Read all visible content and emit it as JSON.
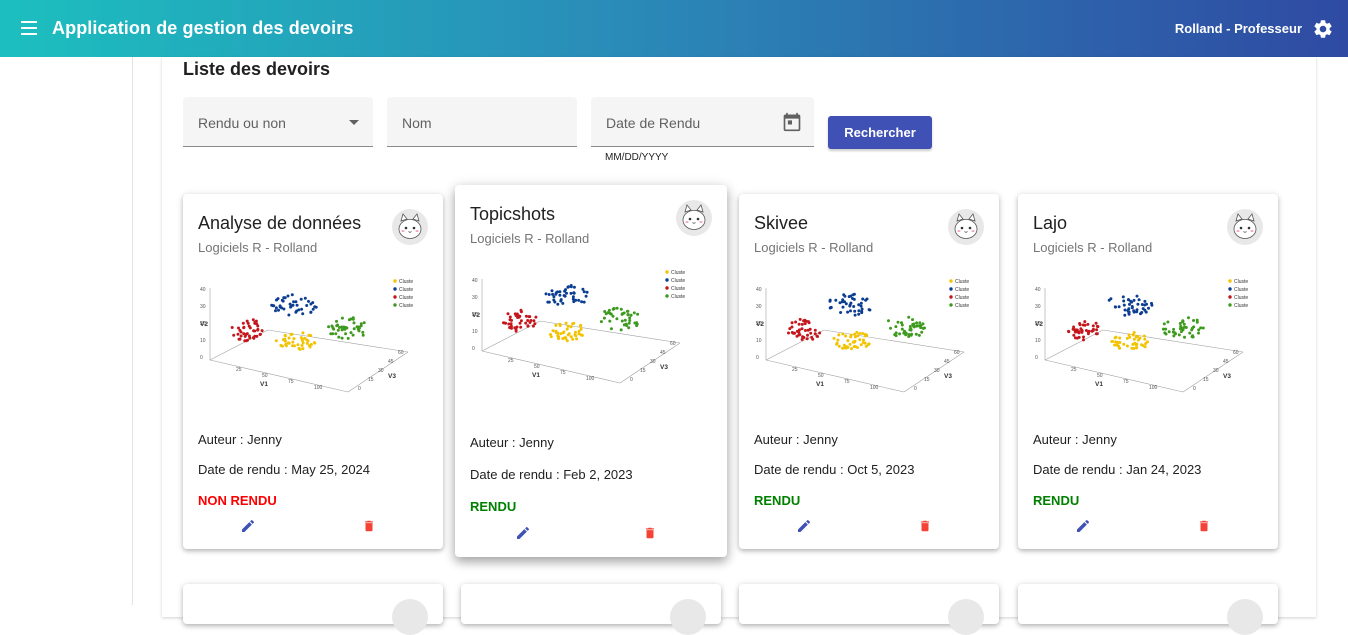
{
  "toolbar": {
    "title": "Application de gestion des devoirs",
    "user": "Rolland - Professeur",
    "menu_icon": "menu-icon",
    "settings_icon": "gear-icon",
    "gradient": [
      "#1cbfbf",
      "#2f4aa3"
    ]
  },
  "list": {
    "title": "Liste des devoirs",
    "filters": {
      "rendu_label": "Rendu ou non",
      "nom_label": "Nom",
      "date_label": "Date de Rendu",
      "date_hint": "MM/DD/YYYY"
    },
    "search_button": "Rechercher"
  },
  "colors": {
    "primary": "#3f51b5",
    "rendu": "#008000",
    "non_rendu": "#ff0000",
    "delete": "#f44336"
  },
  "chart_legend": [
    "Cluster 1",
    "Cluster 2",
    "Cluster 3",
    "Cluster 4"
  ],
  "chart_axes": {
    "x": "V1",
    "y": "V2",
    "z": "V3"
  },
  "chart_ticks": {
    "y": [
      "40",
      "30",
      "20",
      "10",
      "0"
    ],
    "x": [
      "25",
      "50",
      "75",
      "100"
    ],
    "z": [
      "0",
      "15",
      "30",
      "45",
      "60"
    ]
  },
  "cards": [
    {
      "title": "Analyse de données",
      "subtitle": "Logiciels R - Rolland",
      "author": "Auteur : Jenny",
      "date": "Date de rendu : May 25, 2024",
      "status": "NON RENDU",
      "rendu": false
    },
    {
      "title": "Topicshots",
      "subtitle": "Logiciels R - Rolland",
      "author": "Auteur : Jenny",
      "date": "Date de rendu : Feb 2, 2023",
      "status": "RENDU",
      "rendu": true
    },
    {
      "title": "Skivee",
      "subtitle": "Logiciels R - Rolland",
      "author": "Auteur : Jenny",
      "date": "Date de rendu : Oct 5, 2023",
      "status": "RENDU",
      "rendu": true
    },
    {
      "title": "Lajo",
      "subtitle": "Logiciels R - Rolland",
      "author": "Auteur : Jenny",
      "date": "Date de rendu : Jan 24, 2023",
      "status": "RENDU",
      "rendu": true
    }
  ]
}
